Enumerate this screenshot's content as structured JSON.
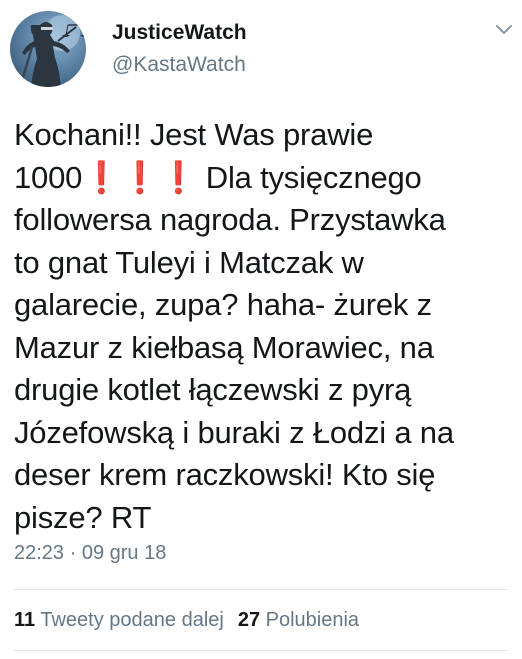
{
  "author": {
    "display_name": "JusticeWatch",
    "handle": "@KastaWatch",
    "avatar_icon": "lady-justice-statue-icon"
  },
  "tweet": {
    "text": "Kochani!! Jest Was prawie\n1000❗❗❗ Dla tysięcznego\nfollowersa nagroda. Przystawka\nto gnat Tuleyi i Matczak w\ngalarecie, zupa? haha- żurek z\nMazur z kiełbasą Morawiec, na\ndrugie kotlet łączewski z pyrą\nJózefowską i buraki z Łodzi a na\ndeser krem raczkowski! Kto się\npisze? RT",
    "timestamp": "22:23 · 09 gru 18"
  },
  "stats": {
    "retweets_count": "11",
    "retweets_label": "Tweety podane dalej",
    "likes_count": "27",
    "likes_label": "Polubienia"
  },
  "menu_icon": "chevron-down-icon",
  "colors": {
    "text_primary": "#14171a",
    "text_secondary": "#657786",
    "divider": "#e1e8ed"
  }
}
